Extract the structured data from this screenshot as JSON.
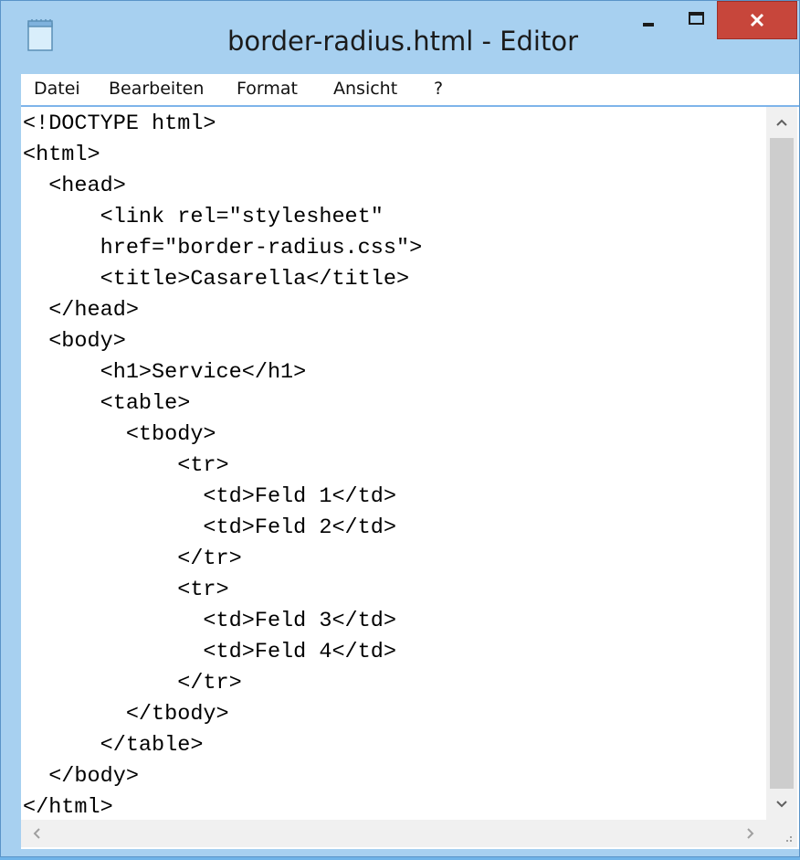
{
  "window": {
    "title": "border-radius.html - Editor"
  },
  "icons": {
    "app": "notepad-icon",
    "minimize": "minimize-icon",
    "maximize": "maximize-icon",
    "close": "close-icon"
  },
  "colors": {
    "frame": "#a7d0f0",
    "close_button": "#c7463b",
    "editor_background": "#ffffff",
    "scrollbar_thumb": "#cdcdcd"
  },
  "menu": {
    "items": [
      "Datei",
      "Bearbeiten",
      "Format",
      "Ansicht",
      "?"
    ]
  },
  "editor": {
    "lines": [
      "<!DOCTYPE html>",
      "<html>",
      "  <head>",
      "      <link rel=\"stylesheet\"",
      "      href=\"border-radius.css\">",
      "      <title>Casarella</title>",
      "  </head>",
      "  <body>",
      "      <h1>Service</h1>",
      "      <table>",
      "        <tbody>",
      "            <tr>",
      "              <td>Feld 1</td>",
      "              <td>Feld 2</td>",
      "            </tr>",
      "            <tr>",
      "              <td>Feld 3</td>",
      "              <td>Feld 4</td>",
      "            </tr>",
      "        </tbody>",
      "      </table>",
      "  </body>",
      "</html>"
    ]
  },
  "scrollbars": {
    "up_arrow": "^",
    "down_arrow": "v",
    "left_arrow": "<",
    "right_arrow": ">"
  }
}
